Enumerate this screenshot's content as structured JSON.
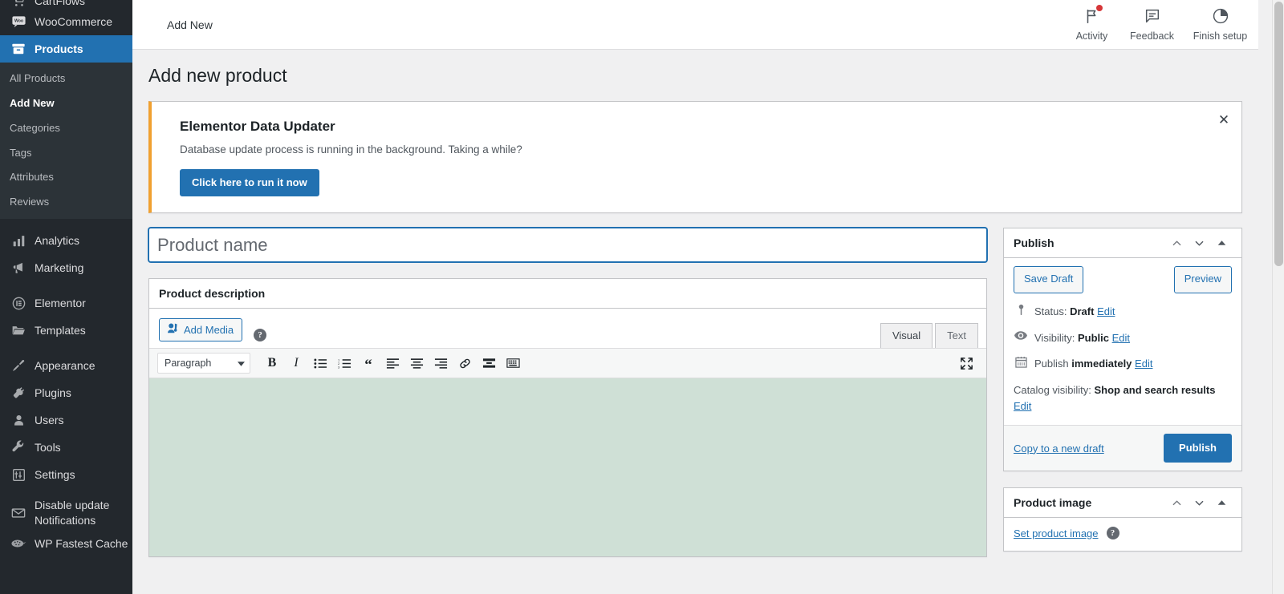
{
  "sidebar": {
    "items": [
      {
        "label": "CartFlows",
        "icon": "cart-icon",
        "current": false,
        "partial": true
      },
      {
        "label": "WooCommerce",
        "icon": "woo-icon",
        "current": false
      },
      {
        "label": "Products",
        "icon": "products-icon",
        "current": true
      }
    ],
    "submenu": [
      {
        "label": "All Products",
        "current": false
      },
      {
        "label": "Add New",
        "current": true
      },
      {
        "label": "Categories",
        "current": false
      },
      {
        "label": "Tags",
        "current": false
      },
      {
        "label": "Attributes",
        "current": false
      },
      {
        "label": "Reviews",
        "current": false
      }
    ],
    "items2": [
      {
        "label": "Analytics",
        "icon": "chart-icon"
      },
      {
        "label": "Marketing",
        "icon": "megaphone-icon"
      }
    ],
    "items3": [
      {
        "label": "Elementor",
        "icon": "elementor-icon"
      },
      {
        "label": "Templates",
        "icon": "folder-icon"
      }
    ],
    "items4": [
      {
        "label": "Appearance",
        "icon": "paintbrush-icon"
      },
      {
        "label": "Plugins",
        "icon": "plug-icon"
      },
      {
        "label": "Users",
        "icon": "user-icon"
      },
      {
        "label": "Tools",
        "icon": "wrench-icon"
      },
      {
        "label": "Settings",
        "icon": "sliders-icon"
      }
    ],
    "items5": [
      {
        "label": "Disable update Notifications",
        "icon": "envelope-icon"
      },
      {
        "label": "WP Fastest Cache",
        "icon": "cheetah-icon"
      }
    ]
  },
  "topbar": {
    "breadcrumb": "Add New",
    "actions": [
      {
        "label": "Activity",
        "icon": "flag-icon",
        "badge": true
      },
      {
        "label": "Feedback",
        "icon": "comment-icon",
        "badge": false
      },
      {
        "label": "Finish setup",
        "icon": "pie-progress-icon",
        "badge": false
      }
    ]
  },
  "page": {
    "title": "Add new product"
  },
  "notice": {
    "heading": "Elementor Data Updater",
    "text": "Database update process is running in the background. Taking a while?",
    "button_label": "Click here to run it now",
    "dismiss_label": "✕",
    "accent_color": "#f0a030"
  },
  "title_field": {
    "placeholder": "Product name",
    "value": ""
  },
  "description_box": {
    "heading": "Product description",
    "add_media_label": "Add Media",
    "help_label": "?",
    "tabs": [
      {
        "label": "Visual",
        "active": true
      },
      {
        "label": "Text",
        "active": false
      }
    ],
    "format_select": "Paragraph",
    "toolbar_buttons": [
      {
        "name": "bold-icon",
        "glyph": "B"
      },
      {
        "name": "italic-icon",
        "glyph": "I"
      },
      {
        "name": "bulleted-list-icon",
        "glyph": ""
      },
      {
        "name": "numbered-list-icon",
        "glyph": ""
      },
      {
        "name": "blockquote-icon",
        "glyph": "“"
      },
      {
        "name": "align-left-icon",
        "glyph": ""
      },
      {
        "name": "align-center-icon",
        "glyph": ""
      },
      {
        "name": "align-right-icon",
        "glyph": ""
      },
      {
        "name": "insert-link-icon",
        "glyph": ""
      },
      {
        "name": "read-more-icon",
        "glyph": ""
      },
      {
        "name": "toolbar-toggle-icon",
        "glyph": ""
      }
    ],
    "fullscreen_label": "Distraction-free writing mode",
    "content": ""
  },
  "publish_box": {
    "heading": "Publish",
    "save_draft_label": "Save Draft",
    "preview_label": "Preview",
    "status_label": "Status:",
    "status_value": "Draft",
    "status_edit": "Edit",
    "visibility_label": "Visibility:",
    "visibility_value": "Public",
    "visibility_edit": "Edit",
    "publish_label": "Publish",
    "publish_value": "immediately",
    "publish_edit": "Edit",
    "catalog_label": "Catalog visibility:",
    "catalog_value": "Shop and search results",
    "catalog_edit": "Edit",
    "copy_draft_label": "Copy to a new draft",
    "publish_button_label": "Publish"
  },
  "product_image_box": {
    "heading": "Product image",
    "set_image_label": "Set product image",
    "help_label": "?"
  },
  "colors": {
    "accent": "#2271b1",
    "sidebar_bg": "#23282d",
    "sidebar_sub_bg": "#2c3338",
    "notice_accent": "#f0a030",
    "editor_body": "#cfe0d6",
    "badge": "#d63638"
  }
}
